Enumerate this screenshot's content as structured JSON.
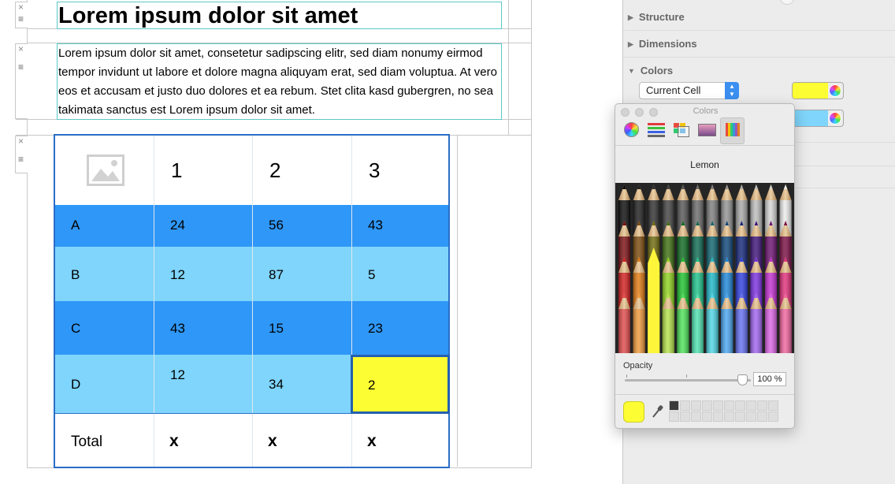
{
  "document": {
    "heading": "Lorem ipsum dolor sit amet",
    "paragraph": "Lorem ipsum dolor sit amet, consetetur sadipscing elitr, sed diam nonumy eirmod tempor invidunt ut labore et dolore magna aliquyam erat, sed diam voluptua. At vero eos et accusam et justo duo dolores et ea rebum. Stet clita kasd gubergren, no sea takimata sanctus est Lorem ipsum dolor sit amet."
  },
  "block_controls": {
    "close_glyph": "×",
    "menu_glyph": "≡"
  },
  "table": {
    "header": [
      "1",
      "2",
      "3"
    ],
    "image_placeholder_icon": "image-icon",
    "rows": [
      {
        "label": "A",
        "values": [
          "24",
          "56",
          "43"
        ]
      },
      {
        "label": "B",
        "values": [
          "12",
          "87",
          "5"
        ]
      },
      {
        "label": "C",
        "values": [
          "43",
          "15",
          "23"
        ]
      },
      {
        "label": "D",
        "values": [
          "12",
          "34",
          "2"
        ]
      }
    ],
    "total": {
      "label": "Total",
      "values": [
        "x",
        "x",
        "x"
      ]
    },
    "colors": {
      "dark_row": "#2f97f7",
      "light_row": "#7fd5fb",
      "selected_cell": "#fdfd33",
      "border": "#2b6ec7"
    }
  },
  "inspector": {
    "sections": {
      "structure": "Structure",
      "dimensions": "Dimensions",
      "colors": "Colors"
    },
    "expand_glyph": "▶",
    "collapse_glyph": "▼",
    "scope_popup": "Current Cell",
    "wells": [
      {
        "color": "#fdfd33",
        "icon": "color-wheel-icon"
      },
      {
        "color": "#7fd5fb",
        "icon": "color-wheel-icon"
      }
    ]
  },
  "colors_panel": {
    "title": "Colors",
    "toolbar": [
      "color-wheel-icon",
      "sliders-icon",
      "palettes-icon",
      "image-palettes-icon",
      "pencils-icon"
    ],
    "selected_name": "Lemon",
    "opacity_label": "Opacity",
    "opacity_value": "100 %",
    "opacity": 1.0,
    "current_color": "#fdfd33"
  }
}
